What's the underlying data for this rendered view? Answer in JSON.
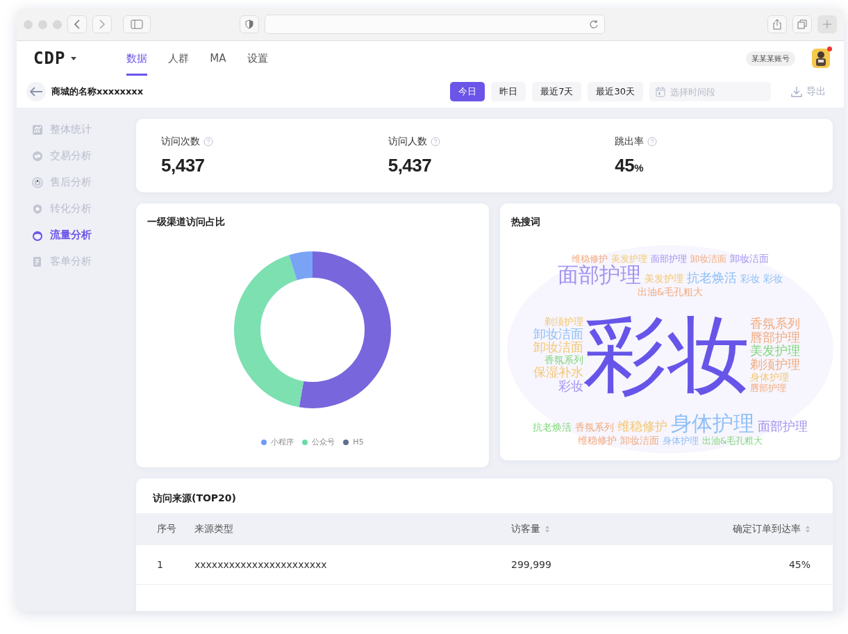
{
  "header": {
    "logo": "CDP",
    "nav": [
      {
        "label": "数据",
        "selected": true
      },
      {
        "label": "人群",
        "selected": false
      },
      {
        "label": "MA",
        "selected": false
      },
      {
        "label": "设置",
        "selected": false
      }
    ],
    "account": "某某某账号",
    "notification": true
  },
  "page": {
    "title": "商城的名称xxxxxxxx",
    "ranges": [
      {
        "label": "今日",
        "selected": true
      },
      {
        "label": "昨日",
        "selected": false
      },
      {
        "label": "最近7天",
        "selected": false
      },
      {
        "label": "最近30天",
        "selected": false
      }
    ],
    "date_placeholder": "选择时间段",
    "export": "导出"
  },
  "sidebar": [
    {
      "label": "整体统计",
      "selected": false
    },
    {
      "label": "交易分析",
      "selected": false
    },
    {
      "label": "售后分析",
      "selected": false
    },
    {
      "label": "转化分析",
      "selected": false
    },
    {
      "label": "流量分析",
      "selected": true
    },
    {
      "label": "客单分析",
      "selected": false
    }
  ],
  "stats": [
    {
      "label": "访问次数",
      "value": "5,437"
    },
    {
      "label": "访问人数",
      "value": "5,437"
    },
    {
      "label": "跳出率",
      "value": "45",
      "unit": "%"
    }
  ],
  "channel_card": {
    "title": "一级渠道访问占比",
    "legend": [
      {
        "label": "小程序",
        "color": "#6f9bf7"
      },
      {
        "label": "公众号",
        "color": "#6ddaa8"
      },
      {
        "label": "H5",
        "color": "#5f6d8e"
      }
    ]
  },
  "hot_words": {
    "title": "热搜词",
    "top": [
      {
        "text": "维稳修护",
        "kind": "xs",
        "color": "#f2a97c"
      },
      {
        "text": "美发护理",
        "kind": "xs",
        "color": "#f3c772"
      },
      {
        "text": "面部护理",
        "kind": "xs",
        "color": "#a193f0"
      },
      {
        "text": "卸妆洁面",
        "kind": "xs",
        "color": "#f2a97c"
      },
      {
        "text": "卸妆洁面",
        "kind": "s",
        "color": "#a193f0"
      },
      {
        "text": "面部护理",
        "kind": "l",
        "color": "#a193f0"
      },
      {
        "text": "美发护理",
        "kind": "s",
        "color": "#f3c772"
      },
      {
        "text": "抗老焕活",
        "kind": "m",
        "color": "#8ec0f6"
      },
      {
        "text": "彩妆",
        "kind": "s",
        "color": "#8ec0f6"
      },
      {
        "text": "彩妆",
        "kind": "s",
        "color": "#8ec0f6"
      },
      {
        "text": "出油&毛孔粗大",
        "kind": "s",
        "color": "#f2a97c"
      }
    ],
    "left": [
      {
        "text": "剃须护理",
        "kind": "s",
        "color": "#f3c772"
      },
      {
        "text": "卸妆洁面",
        "kind": "m",
        "color": "#8ec0f6"
      },
      {
        "text": "卸妆洁面",
        "kind": "m",
        "color": "#f3c772"
      },
      {
        "text": "香氛系列",
        "kind": "s",
        "color": "#7fd77a"
      },
      {
        "text": "保湿补水",
        "kind": "m",
        "color": "#f3c772"
      },
      {
        "text": "彩妆",
        "kind": "m",
        "color": "#a193f0"
      }
    ],
    "center": [
      {
        "text": "彩妆",
        "kind": "xl",
        "color": "#6655e8"
      }
    ],
    "right": [
      {
        "text": "香氛系列",
        "kind": "m",
        "color": "#f2a97c"
      },
      {
        "text": "唇部护理",
        "kind": "m",
        "color": "#f2a97c"
      },
      {
        "text": "美发护理",
        "kind": "m",
        "color": "#7fd77a"
      },
      {
        "text": "剃须护理",
        "kind": "m",
        "color": "#f2a97c"
      },
      {
        "text": "身体护理",
        "kind": "s",
        "color": "#f3c772"
      },
      {
        "text": "唇部护理",
        "kind": "xs",
        "color": "#f2a97c"
      }
    ],
    "bottom": [
      {
        "text": "抗老焕活",
        "kind": "s",
        "color": "#7fd77a"
      },
      {
        "text": "香氛系列",
        "kind": "s",
        "color": "#f2a97c"
      },
      {
        "text": "维稳修护",
        "kind": "m",
        "color": "#f3c772"
      },
      {
        "text": "身体护理",
        "kind": "l",
        "color": "#8ec0f6"
      },
      {
        "text": "面部护理",
        "kind": "m",
        "color": "#a193f0"
      },
      {
        "text": "维稳修护",
        "kind": "s",
        "color": "#f2a97c"
      },
      {
        "text": "卸妆洁面",
        "kind": "s",
        "color": "#f2a97c"
      },
      {
        "text": "身体护理",
        "kind": "xs",
        "color": "#8ec0f6"
      },
      {
        "text": "出油&毛孔粗大",
        "kind": "xs",
        "color": "#7fd77a"
      }
    ]
  },
  "sources": {
    "title": "访问来源(TOP20)",
    "columns": [
      {
        "label": "序号",
        "sortable": false
      },
      {
        "label": "来源类型",
        "sortable": false
      },
      {
        "label": "访客量",
        "sortable": true
      },
      {
        "label": "确定订单到达率",
        "sortable": true
      }
    ],
    "rows": [
      [
        "1",
        "xxxxxxxxxxxxxxxxxxxxxxx",
        "299,999",
        "45%"
      ]
    ]
  }
}
